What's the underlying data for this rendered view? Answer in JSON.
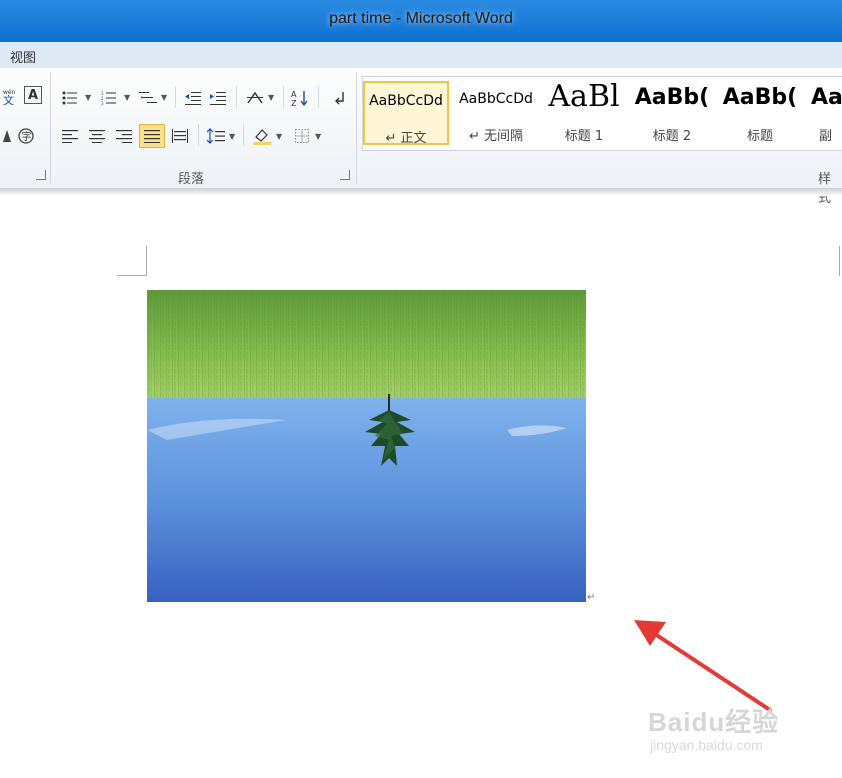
{
  "window": {
    "title": "part time - Microsoft Word"
  },
  "menu": {
    "view": "视图"
  },
  "ribbon": {
    "paragraph_group": "段落",
    "styles_group": "样式",
    "styles": [
      {
        "preview": "AaBbCcDd",
        "name": "↵ 正文",
        "active": true
      },
      {
        "preview": "AaBbCcDd",
        "name": "↵ 无间隔"
      },
      {
        "preview": "AaBl",
        "name": "标题 1"
      },
      {
        "preview": "AaBb(",
        "name": "标题 2"
      },
      {
        "preview": "AaBb(",
        "name": "标题"
      },
      {
        "preview": "Aa",
        "name": "副标"
      }
    ],
    "icons": [
      "phonetic-guide-icon",
      "character-border-icon",
      "bullets-icon",
      "numbering-icon",
      "multilevel-list-icon",
      "decrease-indent-icon",
      "increase-indent-icon",
      "chinese-layout-icon",
      "sort-icon",
      "show-marks-icon",
      "align-left-icon",
      "align-center-icon",
      "align-right-icon",
      "justify-icon",
      "distributed-icon",
      "line-spacing-icon",
      "shading-icon",
      "borders-icon",
      "enclose-char-icon",
      "char-shading-icon"
    ],
    "colors": {
      "active_style": "#f1c34a",
      "shading": "#f4d35e"
    }
  },
  "document": {
    "paragraph_mark": "↵"
  },
  "watermark": {
    "main": "Baidu经验",
    "sub": "jingyan.baidu.com"
  }
}
